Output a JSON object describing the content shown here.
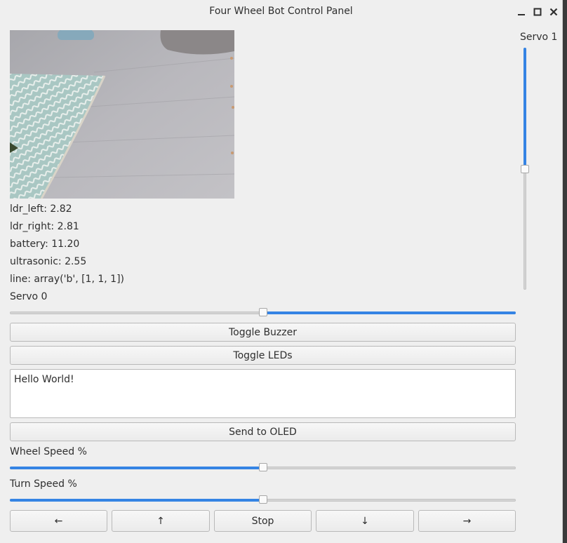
{
  "window": {
    "title": "Four Wheel Bot Control Panel"
  },
  "stats": {
    "ldr_left": "ldr_left: 2.82",
    "ldr_right": "ldr_right: 2.81",
    "battery": "battery: 11.20",
    "ultrasonic": "ultrasonic: 2.55",
    "line": "line: array('b', [1, 1, 1])"
  },
  "servo0": {
    "label": "Servo 0",
    "value_fraction": 0.5
  },
  "servo1": {
    "label": "Servo 1",
    "value_fraction": 0.5
  },
  "buttons": {
    "buzzer": "Toggle Buzzer",
    "leds": "Toggle LEDs",
    "send_oled": "Send to OLED"
  },
  "oled_text": "Hello World!",
  "wheel_speed": {
    "label": "Wheel Speed %",
    "value_fraction": 0.5
  },
  "turn_speed": {
    "label": "Turn Speed %",
    "value_fraction": 0.5
  },
  "nav": {
    "left": "←",
    "up": "↑",
    "stop": "Stop",
    "down": "↓",
    "right": "→"
  },
  "colors": {
    "accent": "#3584e4",
    "window_bg": "#efefef"
  }
}
